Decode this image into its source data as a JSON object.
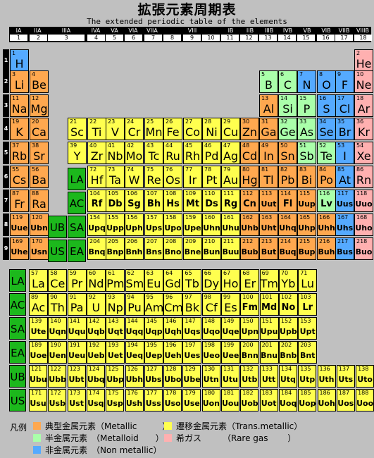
{
  "title": "拡張元素周期表",
  "subtitle": "The extended periodic table of the elements",
  "colors": {
    "metallic": "#ffa84f",
    "trans": "#ffff4f",
    "metalloid": "#aaffaa",
    "nonmetal": "#55aaff",
    "rare": "#ffb0b0",
    "marker": "#1cb81c"
  },
  "groups": [
    {
      "label": "IA",
      "num": "1"
    },
    {
      "label": "IIA",
      "num": "2"
    },
    {
      "label": "IIIA",
      "num": "3"
    },
    {
      "label": "IVA",
      "num": "4"
    },
    {
      "label": "VA",
      "num": "5"
    },
    {
      "label": "VIA",
      "num": "6"
    },
    {
      "label": "VIIA",
      "num": "7"
    },
    {
      "label": "VIII",
      "num": "8"
    },
    {
      "label": "",
      "num": "9"
    },
    {
      "label": "",
      "num": "10"
    },
    {
      "label": "IB",
      "num": "11"
    },
    {
      "label": "IIB",
      "num": "12"
    },
    {
      "label": "IIIB",
      "num": "13"
    },
    {
      "label": "IVB",
      "num": "14"
    },
    {
      "label": "VB",
      "num": "15"
    },
    {
      "label": "VIB",
      "num": "16"
    },
    {
      "label": "VIIB",
      "num": "17"
    },
    {
      "label": "VIIIB",
      "num": "18"
    }
  ],
  "periods": [
    "1",
    "2",
    "3",
    "4",
    "5",
    "6",
    "7",
    "8",
    "9"
  ],
  "markers": [
    "LA",
    "AC",
    "UB",
    "SA",
    "US",
    "EA",
    "LA",
    "AC",
    "SA",
    "EA",
    "UB",
    "US"
  ],
  "elements": [
    {
      "n": "1",
      "s": "H",
      "c": "nonmetal",
      "col": 0,
      "row": 0
    },
    {
      "n": "2",
      "s": "He",
      "c": "rare",
      "col": 17,
      "row": 0
    },
    {
      "n": "3",
      "s": "Li",
      "c": "metallic",
      "col": 0,
      "row": 1
    },
    {
      "n": "4",
      "s": "Be",
      "c": "metallic",
      "col": 1,
      "row": 1
    },
    {
      "n": "5",
      "s": "B",
      "c": "metalloid",
      "col": 12,
      "row": 1
    },
    {
      "n": "6",
      "s": "C",
      "c": "metalloid",
      "col": 13,
      "row": 1
    },
    {
      "n": "7",
      "s": "N",
      "c": "nonmetal",
      "col": 14,
      "row": 1
    },
    {
      "n": "8",
      "s": "O",
      "c": "nonmetal",
      "col": 15,
      "row": 1
    },
    {
      "n": "9",
      "s": "F",
      "c": "nonmetal",
      "col": 16,
      "row": 1
    },
    {
      "n": "10",
      "s": "Ne",
      "c": "rare",
      "col": 17,
      "row": 1
    },
    {
      "n": "11",
      "s": "Na",
      "c": "metallic",
      "col": 0,
      "row": 2
    },
    {
      "n": "12",
      "s": "Mg",
      "c": "metallic",
      "col": 1,
      "row": 2
    },
    {
      "n": "13",
      "s": "Al",
      "c": "metallic",
      "col": 12,
      "row": 2
    },
    {
      "n": "14",
      "s": "Si",
      "c": "metalloid",
      "col": 13,
      "row": 2
    },
    {
      "n": "15",
      "s": "P",
      "c": "metalloid",
      "col": 14,
      "row": 2
    },
    {
      "n": "16",
      "s": "S",
      "c": "nonmetal",
      "col": 15,
      "row": 2
    },
    {
      "n": "17",
      "s": "Cl",
      "c": "nonmetal",
      "col": 16,
      "row": 2
    },
    {
      "n": "18",
      "s": "Ar",
      "c": "rare",
      "col": 17,
      "row": 2
    },
    {
      "n": "19",
      "s": "K",
      "c": "metallic",
      "col": 0,
      "row": 3
    },
    {
      "n": "20",
      "s": "Ca",
      "c": "metallic",
      "col": 1,
      "row": 3
    },
    {
      "n": "21",
      "s": "Sc",
      "c": "trans",
      "col": 3,
      "row": 3
    },
    {
      "n": "22",
      "s": "Ti",
      "c": "trans",
      "col": 4,
      "row": 3
    },
    {
      "n": "23",
      "s": "V",
      "c": "trans",
      "col": 5,
      "row": 3
    },
    {
      "n": "24",
      "s": "Cr",
      "c": "trans",
      "col": 6,
      "row": 3
    },
    {
      "n": "25",
      "s": "Mn",
      "c": "trans",
      "col": 7,
      "row": 3
    },
    {
      "n": "26",
      "s": "Fe",
      "c": "trans",
      "col": 8,
      "row": 3
    },
    {
      "n": "27",
      "s": "Co",
      "c": "trans",
      "col": 9,
      "row": 3
    },
    {
      "n": "28",
      "s": "Ni",
      "c": "trans",
      "col": 10,
      "row": 3
    },
    {
      "n": "29",
      "s": "Cu",
      "c": "trans",
      "col": 11,
      "row": 3
    },
    {
      "n": "30",
      "s": "Zn",
      "c": "metallic",
      "col": 12,
      "row": 3
    },
    {
      "n": "31",
      "s": "Ga",
      "c": "metallic",
      "col": 13,
      "row": 3
    },
    {
      "n": "32",
      "s": "Ge",
      "c": "metalloid",
      "col": 14,
      "row": 3
    },
    {
      "n": "33",
      "s": "As",
      "c": "metalloid",
      "col": 15,
      "row": 3
    },
    {
      "n": "34",
      "s": "Se",
      "c": "nonmetal",
      "col": 16,
      "row": 3
    },
    {
      "n": "35",
      "s": "Br",
      "c": "nonmetal",
      "col": 17,
      "row": 3
    },
    {
      "n": "36",
      "s": "Kr",
      "c": "rare",
      "col": 18,
      "row": 3
    },
    {
      "n": "37",
      "s": "Rb",
      "c": "metallic",
      "col": 0,
      "row": 4
    },
    {
      "n": "38",
      "s": "Sr",
      "c": "metallic",
      "col": 1,
      "row": 4
    },
    {
      "n": "39",
      "s": "Y",
      "c": "trans",
      "col": 3,
      "row": 4
    },
    {
      "n": "40",
      "s": "Zr",
      "c": "trans",
      "col": 4,
      "row": 4
    },
    {
      "n": "41",
      "s": "Nb",
      "c": "trans",
      "col": 5,
      "row": 4
    },
    {
      "n": "42",
      "s": "Mo",
      "c": "trans",
      "col": 6,
      "row": 4
    },
    {
      "n": "43",
      "s": "Tc",
      "c": "trans",
      "col": 7,
      "row": 4
    },
    {
      "n": "44",
      "s": "Ru",
      "c": "trans",
      "col": 8,
      "row": 4
    },
    {
      "n": "45",
      "s": "Rh",
      "c": "trans",
      "col": 9,
      "row": 4
    },
    {
      "n": "46",
      "s": "Pd",
      "c": "trans",
      "col": 10,
      "row": 4
    },
    {
      "n": "47",
      "s": "Ag",
      "c": "trans",
      "col": 11,
      "row": 4
    },
    {
      "n": "48",
      "s": "Cd",
      "c": "metallic",
      "col": 12,
      "row": 4
    },
    {
      "n": "49",
      "s": "In",
      "c": "metallic",
      "col": 13,
      "row": 4
    },
    {
      "n": "50",
      "s": "Sn",
      "c": "metallic",
      "col": 14,
      "row": 4
    },
    {
      "n": "51",
      "s": "Sb",
      "c": "metalloid",
      "col": 15,
      "row": 4
    },
    {
      "n": "52",
      "s": "Te",
      "c": "metalloid",
      "col": 16,
      "row": 4
    },
    {
      "n": "53",
      "s": "I",
      "c": "nonmetal",
      "col": 17,
      "row": 4
    },
    {
      "n": "54",
      "s": "Xe",
      "c": "rare",
      "col": 18,
      "row": 4
    },
    {
      "n": "55",
      "s": "Cs",
      "c": "metallic",
      "col": 0,
      "row": 5
    },
    {
      "n": "56",
      "s": "Ba",
      "c": "metallic",
      "col": 1,
      "row": 5
    },
    {
      "n": "72",
      "s": "Hf",
      "c": "trans",
      "col": 4,
      "row": 5
    },
    {
      "n": "73",
      "s": "Ta",
      "c": "trans",
      "col": 5,
      "row": 5
    },
    {
      "n": "74",
      "s": "W",
      "c": "trans",
      "col": 6,
      "row": 5
    },
    {
      "n": "75",
      "s": "Re",
      "c": "trans",
      "col": 7,
      "row": 5
    },
    {
      "n": "76",
      "s": "Os",
      "c": "trans",
      "col": 8,
      "row": 5
    },
    {
      "n": "77",
      "s": "Ir",
      "c": "trans",
      "col": 9,
      "row": 5
    },
    {
      "n": "78",
      "s": "Pt",
      "c": "trans",
      "col": 10,
      "row": 5
    },
    {
      "n": "79",
      "s": "Au",
      "c": "trans",
      "col": 11,
      "row": 5
    },
    {
      "n": "80",
      "s": "Hg",
      "c": "metallic",
      "col": 12,
      "row": 5
    },
    {
      "n": "81",
      "s": "Tl",
      "c": "metallic",
      "col": 13,
      "row": 5
    },
    {
      "n": "82",
      "s": "Pb",
      "c": "metallic",
      "col": 14,
      "row": 5
    },
    {
      "n": "83",
      "s": "Bi",
      "c": "metallic",
      "col": 15,
      "row": 5
    },
    {
      "n": "84",
      "s": "Po",
      "c": "metallic",
      "col": 16,
      "row": 5
    },
    {
      "n": "85",
      "s": "At",
      "c": "nonmetal",
      "col": 17,
      "row": 5
    },
    {
      "n": "86",
      "s": "Rn",
      "c": "rare",
      "col": 18,
      "row": 5
    },
    {
      "n": "87",
      "s": "Fr",
      "c": "metallic",
      "col": 0,
      "row": 6
    },
    {
      "n": "88",
      "s": "Ra",
      "c": "metallic",
      "col": 1,
      "row": 6
    },
    {
      "n": "104",
      "s": "Rf",
      "c": "trans",
      "col": 4,
      "row": 6
    },
    {
      "n": "105",
      "s": "Db",
      "c": "trans",
      "col": 5,
      "row": 6
    },
    {
      "n": "106",
      "s": "Sg",
      "c": "trans",
      "col": 6,
      "row": 6
    },
    {
      "n": "107",
      "s": "Bh",
      "c": "trans",
      "col": 7,
      "row": 6
    },
    {
      "n": "108",
      "s": "Hs",
      "c": "trans",
      "col": 8,
      "row": 6
    },
    {
      "n": "109",
      "s": "Mt",
      "c": "trans",
      "col": 9,
      "row": 6
    },
    {
      "n": "110",
      "s": "Ds",
      "c": "trans",
      "col": 10,
      "row": 6
    },
    {
      "n": "111",
      "s": "Rg",
      "c": "trans",
      "col": 11,
      "row": 6
    },
    {
      "n": "112",
      "s": "Cn",
      "c": "metallic",
      "col": 12,
      "row": 6
    },
    {
      "n": "113",
      "s": "Uut",
      "c": "metallic",
      "col": 13,
      "row": 6
    },
    {
      "n": "114",
      "s": "Fl",
      "c": "metallic",
      "col": 14,
      "row": 6
    },
    {
      "n": "115",
      "s": "Uup",
      "c": "metallic",
      "col": 15,
      "row": 6
    },
    {
      "n": "116",
      "s": "Lv",
      "c": "metalloid",
      "col": 16,
      "row": 6
    },
    {
      "n": "117",
      "s": "Uus",
      "c": "nonmetal",
      "col": 17,
      "row": 6
    },
    {
      "n": "118",
      "s": "Uuo",
      "c": "rare",
      "col": 18,
      "row": 6
    },
    {
      "n": "119",
      "s": "Uue",
      "c": "metallic",
      "col": 0,
      "row": 7
    },
    {
      "n": "120",
      "s": "Ubn",
      "c": "metallic",
      "col": 1,
      "row": 7
    },
    {
      "n": "154",
      "s": "Upq",
      "c": "trans",
      "col": 4,
      "row": 7
    },
    {
      "n": "155",
      "s": "Upp",
      "c": "trans",
      "col": 5,
      "row": 7
    },
    {
      "n": "156",
      "s": "Uph",
      "c": "trans",
      "col": 6,
      "row": 7
    },
    {
      "n": "157",
      "s": "Ups",
      "c": "trans",
      "col": 7,
      "row": 7
    },
    {
      "n": "158",
      "s": "Upo",
      "c": "trans",
      "col": 8,
      "row": 7
    },
    {
      "n": "159",
      "s": "Upe",
      "c": "trans",
      "col": 9,
      "row": 7
    },
    {
      "n": "160",
      "s": "Uhn",
      "c": "trans",
      "col": 10,
      "row": 7
    },
    {
      "n": "161",
      "s": "Uhu",
      "c": "trans",
      "col": 11,
      "row": 7
    },
    {
      "n": "162",
      "s": "Uhb",
      "c": "metallic",
      "col": 12,
      "row": 7
    },
    {
      "n": "163",
      "s": "Uht",
      "c": "metallic",
      "col": 13,
      "row": 7
    },
    {
      "n": "164",
      "s": "Uhq",
      "c": "metallic",
      "col": 14,
      "row": 7
    },
    {
      "n": "165",
      "s": "Uhp",
      "c": "metallic",
      "col": 15,
      "row": 7
    },
    {
      "n": "166",
      "s": "Uhh",
      "c": "metallic",
      "col": 16,
      "row": 7
    },
    {
      "n": "167",
      "s": "Uhs",
      "c": "nonmetal",
      "col": 17,
      "row": 7
    },
    {
      "n": "168",
      "s": "Uho",
      "c": "rare",
      "col": 18,
      "row": 7
    },
    {
      "n": "169",
      "s": "Uhe",
      "c": "metallic",
      "col": 0,
      "row": 8
    },
    {
      "n": "170",
      "s": "Usn",
      "c": "metallic",
      "col": 1,
      "row": 8
    },
    {
      "n": "204",
      "s": "Bnq",
      "c": "trans",
      "col": 4,
      "row": 8
    },
    {
      "n": "205",
      "s": "Bnp",
      "c": "trans",
      "col": 5,
      "row": 8
    },
    {
      "n": "206",
      "s": "Bnh",
      "c": "trans",
      "col": 6,
      "row": 8
    },
    {
      "n": "207",
      "s": "Bns",
      "c": "trans",
      "col": 7,
      "row": 8
    },
    {
      "n": "208",
      "s": "Bno",
      "c": "trans",
      "col": 8,
      "row": 8
    },
    {
      "n": "209",
      "s": "Bne",
      "c": "trans",
      "col": 9,
      "row": 8
    },
    {
      "n": "210",
      "s": "Bun",
      "c": "trans",
      "col": 10,
      "row": 8
    },
    {
      "n": "211",
      "s": "Buu",
      "c": "trans",
      "col": 11,
      "row": 8
    },
    {
      "n": "212",
      "s": "Bub",
      "c": "metallic",
      "col": 12,
      "row": 8
    },
    {
      "n": "213",
      "s": "But",
      "c": "metallic",
      "col": 13,
      "row": 8
    },
    {
      "n": "214",
      "s": "Buq",
      "c": "metallic",
      "col": 14,
      "row": 8
    },
    {
      "n": "215",
      "s": "Bup",
      "c": "metallic",
      "col": 15,
      "row": 8
    },
    {
      "n": "216",
      "s": "Buh",
      "c": "metallic",
      "col": 16,
      "row": 8
    },
    {
      "n": "217",
      "s": "Bus",
      "c": "nonmetal",
      "col": 17,
      "row": 8
    },
    {
      "n": "218",
      "s": "Buo",
      "c": "rare",
      "col": 18,
      "row": 8
    }
  ],
  "series": [
    {
      "key": "LA",
      "row": 0,
      "elements": [
        [
          "57",
          "La"
        ],
        [
          "58",
          "Ce"
        ],
        [
          "59",
          "Pr"
        ],
        [
          "60",
          "Nd"
        ],
        [
          "61",
          "Pm"
        ],
        [
          "62",
          "Sm"
        ],
        [
          "63",
          "Eu"
        ],
        [
          "64",
          "Gd"
        ],
        [
          "65",
          "Tb"
        ],
        [
          "66",
          "Dy"
        ],
        [
          "67",
          "Ho"
        ],
        [
          "68",
          "Er"
        ],
        [
          "69",
          "Tm"
        ],
        [
          "70",
          "Yb"
        ],
        [
          "71",
          "Lu"
        ]
      ]
    },
    {
      "key": "AC",
      "row": 1,
      "elements": [
        [
          "89",
          "Ac"
        ],
        [
          "90",
          "Th"
        ],
        [
          "91",
          "Pa"
        ],
        [
          "92",
          "U"
        ],
        [
          "93",
          "Np"
        ],
        [
          "94",
          "Pu"
        ],
        [
          "95",
          "Am"
        ],
        [
          "96",
          "Cm"
        ],
        [
          "97",
          "Bk"
        ],
        [
          "98",
          "Cf"
        ],
        [
          "99",
          "Es"
        ],
        [
          "100",
          "Fm"
        ],
        [
          "101",
          "Md"
        ],
        [
          "102",
          "No"
        ],
        [
          "103",
          "Lr"
        ]
      ]
    },
    {
      "key": "SA",
      "row": 2,
      "elements": [
        [
          "139",
          "Ute"
        ],
        [
          "140",
          "Uqn"
        ],
        [
          "141",
          "Uqu"
        ],
        [
          "142",
          "Uqb"
        ],
        [
          "143",
          "Uqt"
        ],
        [
          "144",
          "Uqq"
        ],
        [
          "145",
          "Uqp"
        ],
        [
          "146",
          "Uqh"
        ],
        [
          "147",
          "Uqs"
        ],
        [
          "148",
          "Uqo"
        ],
        [
          "149",
          "Uqe"
        ],
        [
          "150",
          "Upn"
        ],
        [
          "151",
          "Upu"
        ],
        [
          "152",
          "Upb"
        ],
        [
          "153",
          "Upt"
        ]
      ]
    },
    {
      "key": "EA",
      "row": 3,
      "elements": [
        [
          "189",
          "Uoe"
        ],
        [
          "190",
          "Uen"
        ],
        [
          "191",
          "Ueu"
        ],
        [
          "192",
          "Ueb"
        ],
        [
          "193",
          "Uet"
        ],
        [
          "194",
          "Ueq"
        ],
        [
          "195",
          "Uep"
        ],
        [
          "196",
          "Ueh"
        ],
        [
          "197",
          "Ues"
        ],
        [
          "198",
          "Ueo"
        ],
        [
          "199",
          "Uee"
        ],
        [
          "200",
          "Bnn"
        ],
        [
          "201",
          "Bnu"
        ],
        [
          "202",
          "Bnb"
        ],
        [
          "203",
          "Bnt"
        ]
      ]
    },
    {
      "key": "UB",
      "row": 4,
      "elements": [
        [
          "121",
          "Ubu"
        ],
        [
          "122",
          "Ubb"
        ],
        [
          "123",
          "Ubt"
        ],
        [
          "124",
          "Ubq"
        ],
        [
          "125",
          "Ubp"
        ],
        [
          "126",
          "Ubh"
        ],
        [
          "127",
          "Ubs"
        ],
        [
          "128",
          "Ubo"
        ],
        [
          "129",
          "Ube"
        ],
        [
          "130",
          "Utn"
        ],
        [
          "131",
          "Utu"
        ],
        [
          "132",
          "Utb"
        ],
        [
          "133",
          "Utt"
        ],
        [
          "134",
          "Utq"
        ],
        [
          "135",
          "Utp"
        ],
        [
          "136",
          "Uth"
        ],
        [
          "137",
          "Uts"
        ],
        [
          "138",
          "Uto"
        ]
      ]
    },
    {
      "key": "US",
      "row": 5,
      "elements": [
        [
          "171",
          "Usu"
        ],
        [
          "172",
          "Usb"
        ],
        [
          "173",
          "Ust"
        ],
        [
          "174",
          "Usq"
        ],
        [
          "175",
          "Usp"
        ],
        [
          "176",
          "Ush"
        ],
        [
          "177",
          "Uss"
        ],
        [
          "178",
          "Uso"
        ],
        [
          "179",
          "Use"
        ],
        [
          "180",
          "Uon"
        ],
        [
          "181",
          "Uou"
        ],
        [
          "182",
          "Uob"
        ],
        [
          "183",
          "Uot"
        ],
        [
          "184",
          "Uoq"
        ],
        [
          "185",
          "Uop"
        ],
        [
          "186",
          "Uoh"
        ],
        [
          "187",
          "Uos"
        ],
        [
          "188",
          "Uoo"
        ]
      ]
    }
  ],
  "legend": {
    "label": "凡例",
    "items": [
      {
        "text": "典型金属元素（Metallic　　　）",
        "c": "metallic"
      },
      {
        "text": "遷移金属元素（Trans.metallic）",
        "c": "trans"
      },
      {
        "text": "半金属元素　（Metalloid　　）",
        "c": "metalloid"
      },
      {
        "text": "希ガス　　　（Rare gas　　 ）",
        "c": "rare"
      },
      {
        "text": "非金属元素　（Non metallic）",
        "c": "nonmetal"
      }
    ]
  }
}
